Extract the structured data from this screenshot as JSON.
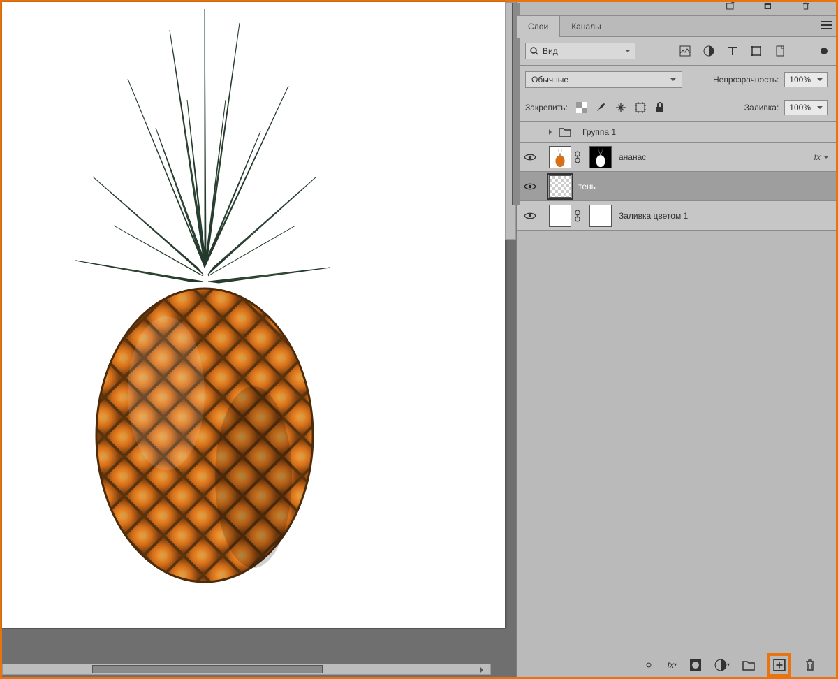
{
  "tabs": {
    "layers": "Слои",
    "channels": "Каналы"
  },
  "filter": {
    "kind_label": "Вид"
  },
  "blend": {
    "mode": "Обычные",
    "opacity_label": "Непрозрачность:",
    "opacity_value": "100%"
  },
  "lock": {
    "label": "Закрепить:",
    "fill_label": "Заливка:",
    "fill_value": "100%"
  },
  "layers": {
    "group1": "Группа 1",
    "pineapple": "ананас",
    "shadow": "тень",
    "fill1": "Заливка цветом 1",
    "fx": "fx"
  }
}
